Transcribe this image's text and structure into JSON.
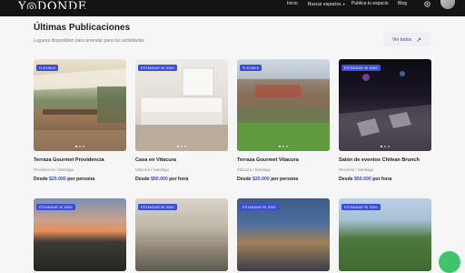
{
  "header": {
    "logo": "Y◎DONDE",
    "nav": [
      {
        "label": "Inicio"
      },
      {
        "label": "Buscar espacios",
        "has_dropdown": true
      },
      {
        "label": "Publica tu espacio"
      },
      {
        "label": "Blog"
      }
    ],
    "icons": [
      "gear-icon",
      "avatar"
    ]
  },
  "section": {
    "title": "Últimas Publicaciones",
    "subtitle": "Lugares disponibles para arrendar para tus actividades",
    "view_all": "Ver todos",
    "view_all_icon": "arrow-up-right-icon"
  },
  "listings": [
    {
      "badge": "FLEXIBLE",
      "name": "Terraza Gourmet Providencia",
      "location": "Providencia / Santiago",
      "price_prefix": "Desde",
      "price": "$25.000",
      "unit": "por persona"
    },
    {
      "badge": "ESTANDAR 90 DÍAS",
      "name": "Casa en Vitacura",
      "location": "Vitacura / Santiago",
      "price_prefix": "Desde",
      "price": "$80.000",
      "unit": "por hora"
    },
    {
      "badge": "FLEXIBLE",
      "name": "Terraza Gourmet Vitacura",
      "location": "Vitacura / Santiago",
      "price_prefix": "Desde",
      "price": "$25.000",
      "unit": "por persona"
    },
    {
      "badge": "ESTANDAR 30 DÍAS",
      "name": "Salón de eventos Chilean Brunch",
      "location": "Recoleta / Santiago",
      "price_prefix": "Desde",
      "price": "$60.000",
      "unit": "por hora"
    },
    {
      "badge": "ESTANDAR 30 DÍAS"
    },
    {
      "badge": "ESTANDAR 90 DÍAS"
    },
    {
      "badge": "ESTANDAR 90 DÍAS"
    },
    {
      "badge": "ESTANDAR 30 DÍAS"
    }
  ],
  "colors": {
    "accent": "#3d4ed6",
    "topbar": "#141414",
    "chat": "#3fc46a"
  }
}
